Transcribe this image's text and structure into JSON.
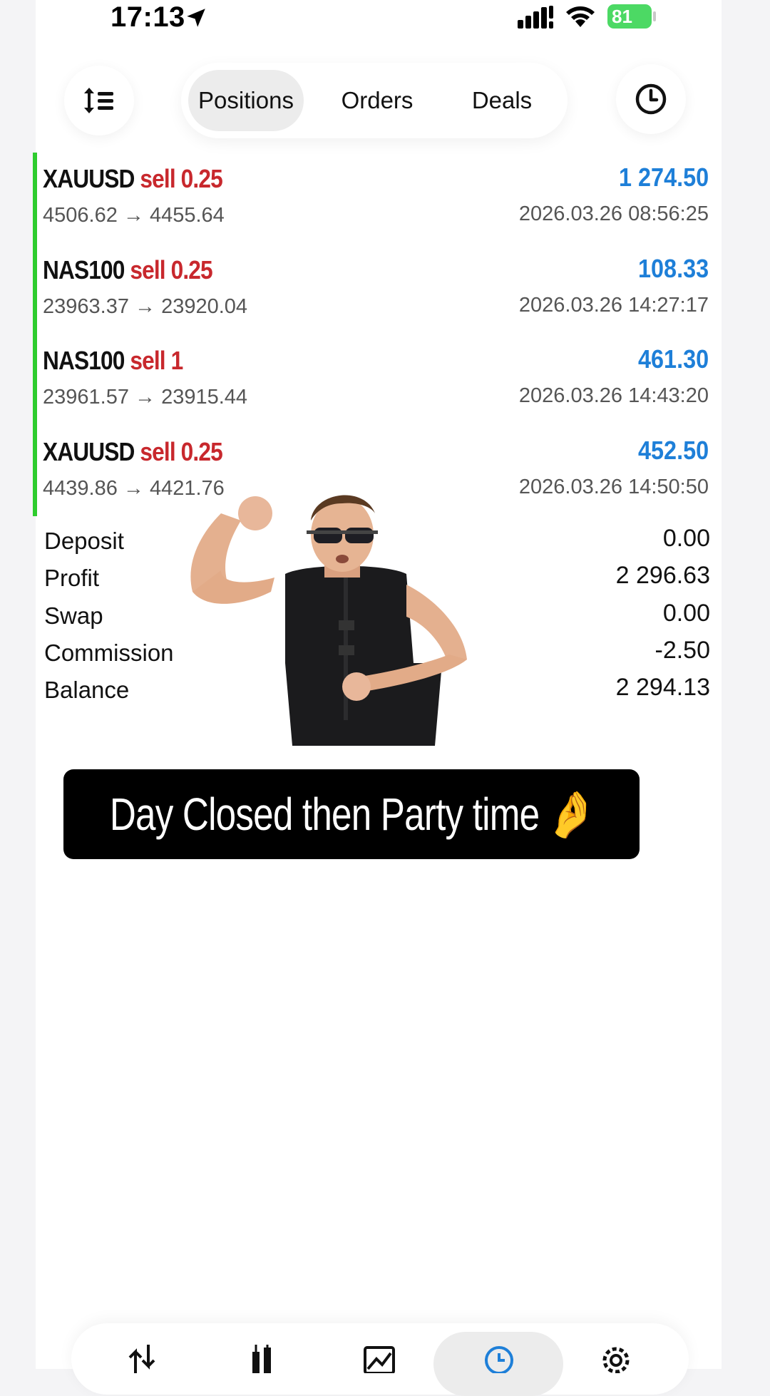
{
  "status_bar": {
    "time": "17:13",
    "battery": "81"
  },
  "segments": [
    {
      "label": "Positions",
      "active": true
    },
    {
      "label": "Orders",
      "active": false
    },
    {
      "label": "Deals",
      "active": false
    }
  ],
  "positions": [
    {
      "symbol": "XAUUSD",
      "side": "sell 0.25",
      "prices": "4506.62 → 4455.64",
      "profit": "1 274.50",
      "time": "2026.03.26 08:56:25"
    },
    {
      "symbol": "NAS100",
      "side": "sell 0.25",
      "prices": "23963.37 → 23920.04",
      "profit": "108.33",
      "time": "2026.03.26 14:27:17"
    },
    {
      "symbol": "NAS100",
      "side": "sell 1",
      "prices": "23961.57 → 23915.44",
      "profit": "461.30",
      "time": "2026.03.26 14:43:20"
    },
    {
      "symbol": "XAUUSD",
      "side": "sell 0.25",
      "prices": "4439.86 → 4421.76",
      "profit": "452.50",
      "time": "2026.03.26 14:50:50"
    }
  ],
  "summary": [
    {
      "label": "Deposit",
      "value": "0.00"
    },
    {
      "label": "Profit",
      "value": "2 296.63"
    },
    {
      "label": "Swap",
      "value": "0.00"
    },
    {
      "label": "Commission",
      "value": "-2.50"
    },
    {
      "label": "Balance",
      "value": "2 294.13"
    }
  ],
  "caption": "Day Closed then Party time 🤌",
  "colors": {
    "sell": "#c8282d",
    "profit": "#1e7fd8",
    "position_bar": "#2ecc2e"
  },
  "tabbar": {
    "items": [
      "quotes-icon",
      "chart-icon",
      "trade-icon",
      "history-icon",
      "settings-icon"
    ],
    "active": "history-icon"
  }
}
